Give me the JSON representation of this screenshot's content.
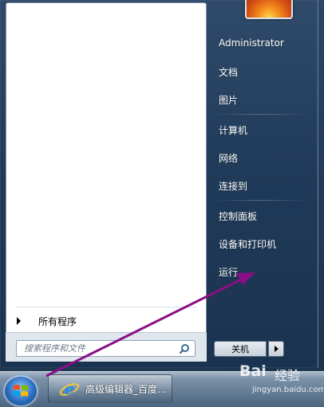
{
  "left_pane": {
    "all_programs_label": "所有程序",
    "search_placeholder": "搜索程序和文件"
  },
  "right_pane": {
    "items": [
      "Administrator",
      "文档",
      "图片",
      "计算机",
      "网络",
      "连接到",
      "控制面板",
      "设备和打印机",
      "运行..."
    ],
    "shutdown_label": "关机"
  },
  "taskbar": {
    "button_label": "高级编辑器_百度..."
  },
  "watermark": {
    "logo": "Bai",
    "text": "经验",
    "url": "jingyan.baidu.com"
  },
  "annotation": {
    "color": "#8a0f87"
  },
  "icons": [
    "search-icon",
    "windows-logo-icon",
    "internet-explorer-icon",
    "chevron-right-icon"
  ]
}
